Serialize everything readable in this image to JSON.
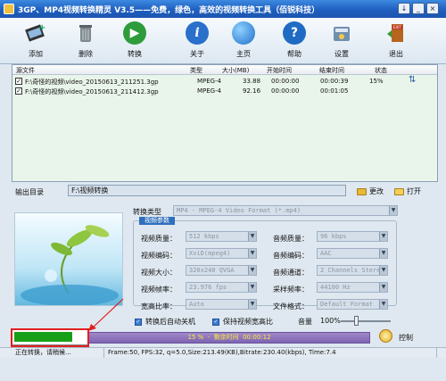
{
  "window": {
    "title": "3GP、MP4视频转换精灵 V3.5——免费，绿色，高效的视频转换工具（佰锐科技）",
    "buttons": [
      "↓",
      "_",
      "×"
    ]
  },
  "toolbar": {
    "add": "添加",
    "delete": "删除",
    "convert": "转换",
    "about": "关于",
    "home": "主页",
    "help": "帮助",
    "settings": "设置",
    "exit": "退出"
  },
  "files": {
    "headers": [
      "源文件",
      "类型",
      "大小(MB)",
      "开始时间",
      "结束时间",
      "状态"
    ],
    "rows": [
      {
        "name": "F:\\奇怪的视频\\video_20150613_211251.3gp",
        "type": "MPEG-4",
        "size": "33.88",
        "start": "00:00:00",
        "end": "00:00:39",
        "status": "15%"
      },
      {
        "name": "F:\\奇怪的视频\\video_20150613_211412.3gp",
        "type": "MPEG-4",
        "size": "92.16",
        "start": "00:00:00",
        "end": "00:01:05",
        "status": ""
      }
    ]
  },
  "output": {
    "label": "输出目录",
    "path": "F:\\视频转换",
    "change": "更改",
    "open": "打开"
  },
  "settings": {
    "convert_type_label": "转换类型",
    "convert_type": "MP4 - MPEG-4 Video Format (*.mp4)",
    "tab_label": "视频参数",
    "video_quality_label": "视频质量：",
    "video_quality": "512 kbps",
    "video_codec_label": "视频编码：",
    "video_codec": "XviD(mpeg4)",
    "video_size_label": "视频大小：",
    "video_size": "320x240 QVGA",
    "video_fps_label": "视频帧率：",
    "video_fps": "23.976 fps",
    "aspect_label": "宽高比率：",
    "aspect": "Auto",
    "audio_quality_label": "音频质量：",
    "audio_quality": "96  kbps",
    "audio_codec_label": "音频编码：",
    "audio_codec": "AAC",
    "audio_channel_label": "音频通道：",
    "audio_channel": "2 Channels Stere",
    "sample_rate_label": "采样频率：",
    "sample_rate": "44100 Hz",
    "file_format_label": "文件格式：",
    "file_format": "Default Format"
  },
  "options": {
    "shutdown": "转换后自动关机",
    "keep_ratio": "保持视频宽高比",
    "volume_label": "音量",
    "volume": "100%"
  },
  "progress": {
    "text": "15 %  -  剩余时间  00:00:12",
    "percent": 0.15,
    "control": "控制"
  },
  "status": {
    "left": "正在转换，请稍候...",
    "info": "Frame:50, FPS:32, q=5.0,Size:213.49(KB),Bitrate:230.40(kbps), Time:7.4"
  },
  "colors": {
    "titlebar": "#1f5fbf",
    "table_bg": "#e9f5ea",
    "progress_bar": "#7e64b2",
    "progress_fill": "#17a017",
    "highlight": "#e02020"
  }
}
